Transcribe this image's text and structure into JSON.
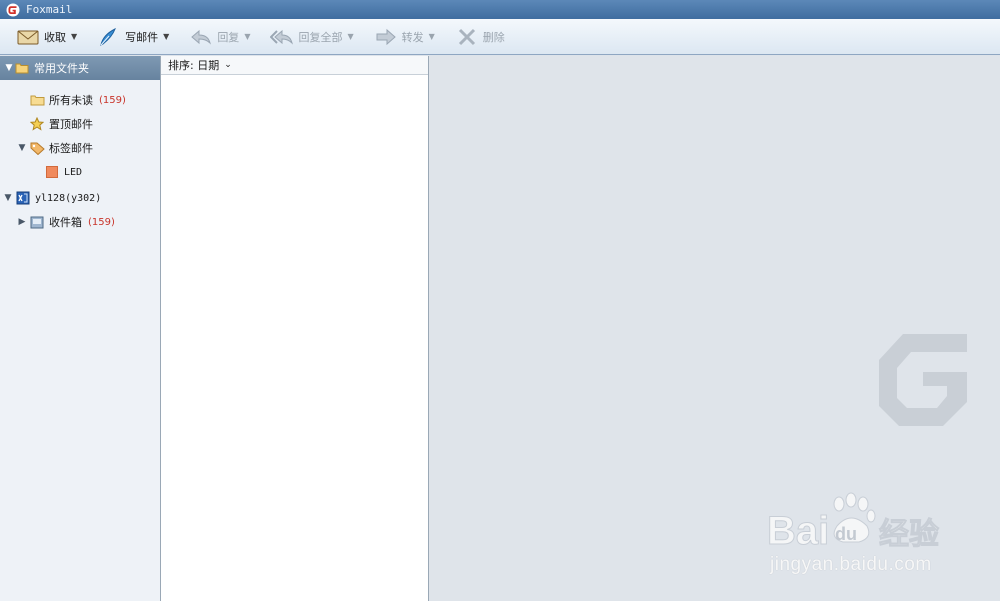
{
  "window": {
    "title": "Foxmail"
  },
  "toolbar": {
    "receive_label": "收取",
    "compose_label": "写邮件",
    "reply_label": "回复",
    "reply_all_label": "回复全部",
    "forward_label": "转发",
    "delete_label": "删除"
  },
  "folders": {
    "common_header": "常用文件夹",
    "all_unread_label": "所有未读",
    "all_unread_count": "(159)",
    "pinned_label": "置顶邮件",
    "tagged_label": "标签邮件",
    "tag_led_label": "LED",
    "account_label": "yl128(y302)",
    "inbox_label": "收件箱",
    "inbox_count": "(159)"
  },
  "list": {
    "sort_label": "排序: 日期"
  },
  "watermark": {
    "baidu_url": "jingyan.baidu.com"
  },
  "colors": {
    "accent": "#5c88b8",
    "count": "#c8342a",
    "tag_led": "#f08a5d"
  }
}
